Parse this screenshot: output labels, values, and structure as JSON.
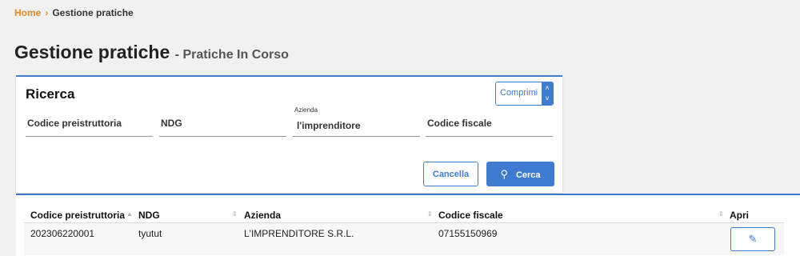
{
  "breadcrumb": {
    "home": "Home",
    "separator": "›",
    "current": "Gestione pratiche"
  },
  "page": {
    "title": "Gestione pratiche",
    "subtitle": "- Pratiche In Corso"
  },
  "search": {
    "title": "Ricerca",
    "collapse_label": "Comprimi",
    "collapse_icon": "chevron-up-down-icon",
    "fields": [
      {
        "label": "Codice preistruttoria",
        "value": ""
      },
      {
        "label": "NDG",
        "value": ""
      },
      {
        "label": "Azienda",
        "value": "l'imprenditore"
      },
      {
        "label": "Codice fiscale",
        "value": ""
      }
    ],
    "cancel_label": "Cancella",
    "search_label": "Cerca",
    "search_icon": "search-icon"
  },
  "table": {
    "columns": [
      "Codice preistruttoria",
      "NDG",
      "Azienda",
      "Codice fiscale",
      "Apri"
    ],
    "rows": [
      {
        "codice": "202306220001",
        "ndg": "tyutut",
        "azienda": "L'IMPRENDITORE S.R.L.",
        "codice_fiscale": "07155150969",
        "apri_icon": "pencil-icon"
      }
    ]
  },
  "colors": {
    "accent": "#3e7bd1",
    "breadcrumb": "#e08a2c",
    "background": "#f1f1f1"
  }
}
